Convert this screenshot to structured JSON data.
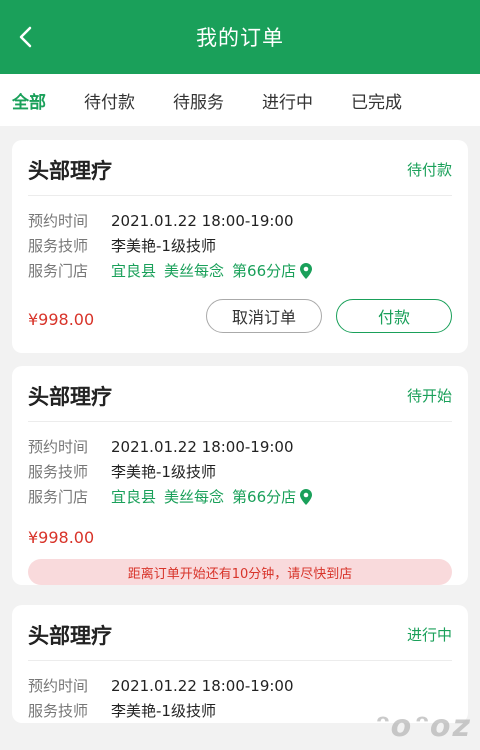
{
  "header": {
    "title": "我的订单",
    "back_icon": "chevron-left-icon"
  },
  "tabs": [
    {
      "label": "全部",
      "active": true
    },
    {
      "label": "待付款",
      "active": false
    },
    {
      "label": "待服务",
      "active": false
    },
    {
      "label": "进行中",
      "active": false
    },
    {
      "label": "已完成",
      "active": false
    }
  ],
  "labels": {
    "time": "预约时间",
    "tech": "服务技师",
    "store": "服务门店"
  },
  "orders": [
    {
      "service": "头部理疗",
      "status": "待付款",
      "time": "2021.01.22 18:00-19:00",
      "tech": "李美艳-1级技师",
      "store_county": "宜良县",
      "store_brand": "美丝每念",
      "store_branch": "第66分店",
      "price": "¥998.00",
      "cancel_label": "取消订单",
      "pay_label": "付款"
    },
    {
      "service": "头部理疗",
      "status": "待开始",
      "time": "2021.01.22 18:00-19:00",
      "tech": "李美艳-1级技师",
      "store_county": "宜良县",
      "store_brand": "美丝每念",
      "store_branch": "第66分店",
      "price": "¥998.00",
      "notice": "距离订单开始还有10分钟，请尽快到店"
    },
    {
      "service": "头部理疗",
      "status": "进行中",
      "time": "2021.01.22 18:00-19:00",
      "tech": "李美艳-1级技师"
    }
  ],
  "colors": {
    "primary": "#1aa05a",
    "price": "#d8342a",
    "notice_bg": "#f9dadc"
  },
  "watermark": "ᵔoᵔoz"
}
